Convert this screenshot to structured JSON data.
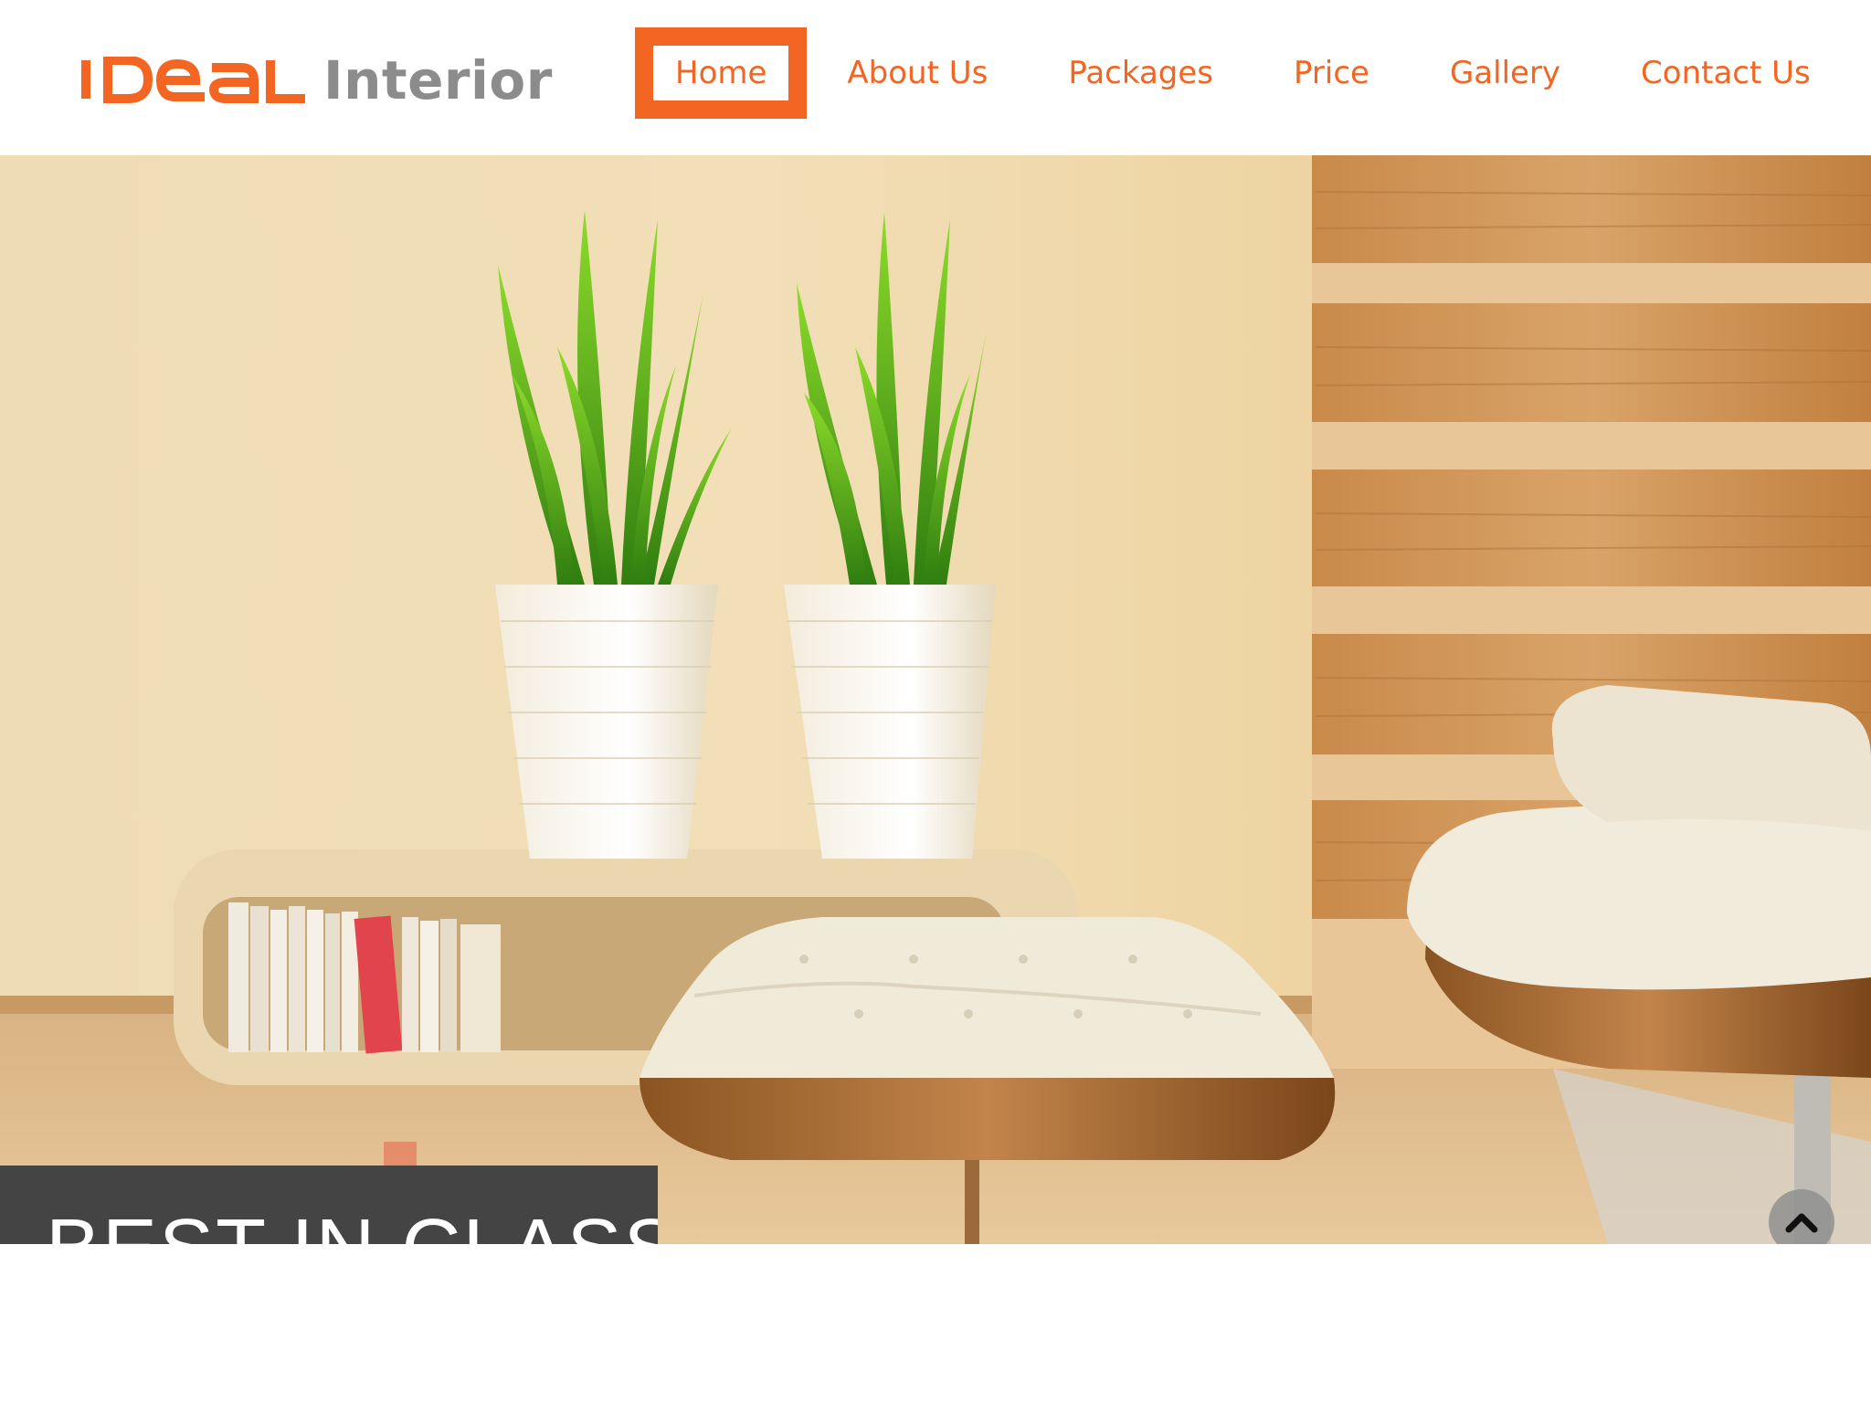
{
  "brand": {
    "logo_wordmark": "IDEAL",
    "name": "Interior",
    "accent_color": "#f26522",
    "text_gray": "#8c8c8c"
  },
  "nav": {
    "items": [
      {
        "label": "Home",
        "active": true
      },
      {
        "label": "About Us",
        "active": false
      },
      {
        "label": "Packages",
        "active": false
      },
      {
        "label": "Price",
        "active": false
      },
      {
        "label": "Gallery",
        "active": false
      },
      {
        "label": "Contact Us",
        "active": false
      }
    ]
  },
  "hero": {
    "caption": "BEST IN CLASS",
    "scroll_top_icon": "chevron-up-icon"
  }
}
